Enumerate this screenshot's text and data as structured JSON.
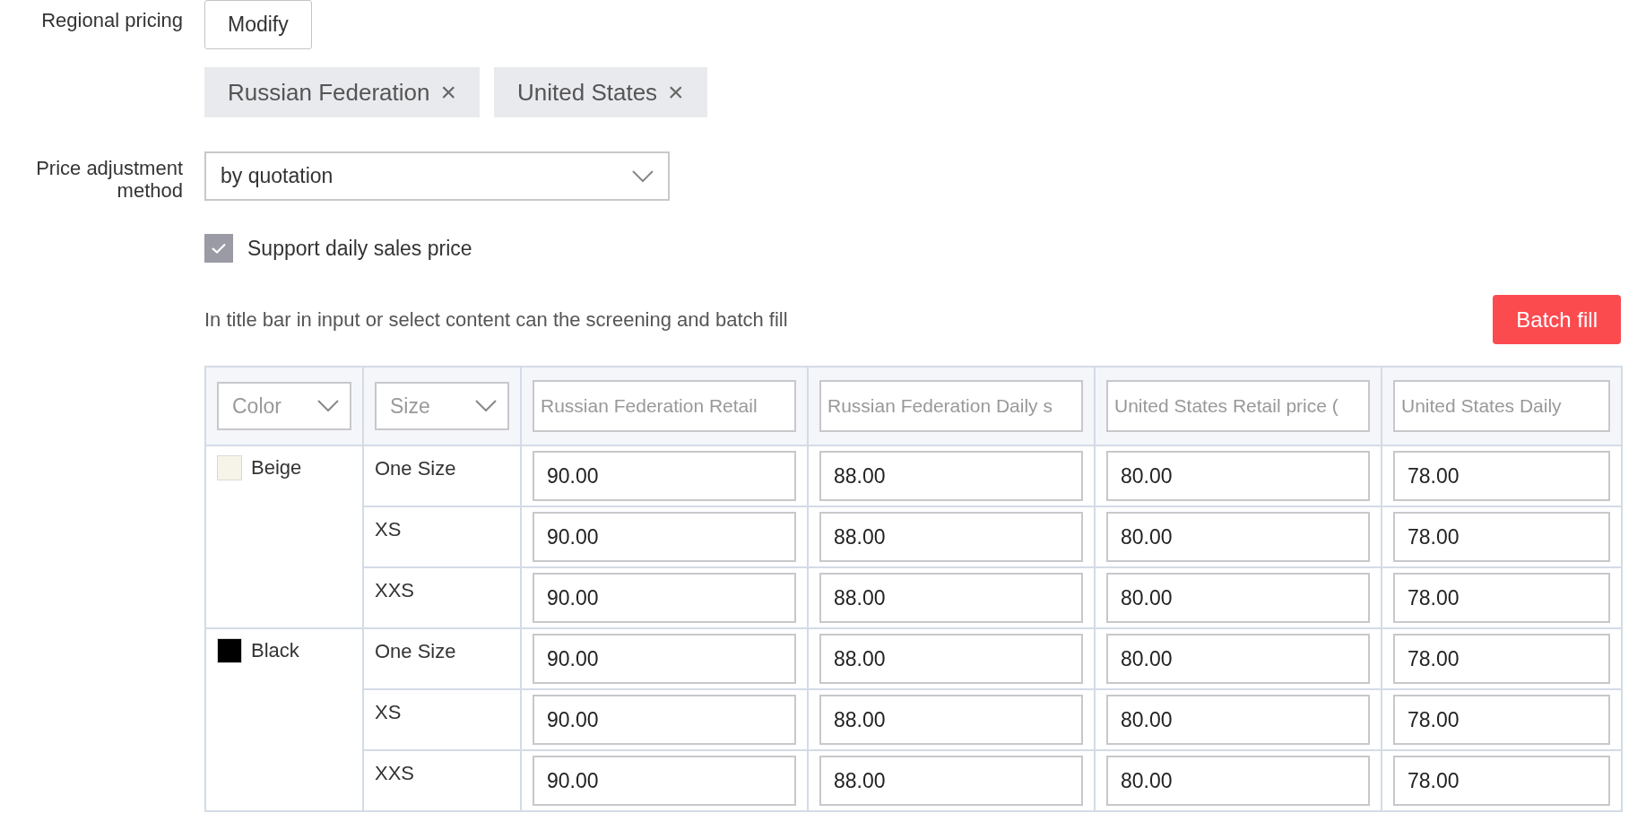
{
  "regional_pricing": {
    "label": "Regional pricing",
    "button": "Modify",
    "regions": [
      {
        "name": "Russian Federation",
        "remove": "×"
      },
      {
        "name": "United States",
        "remove": "×"
      }
    ]
  },
  "price_adjustment": {
    "label": "Price adjustment method",
    "value": "by quotation"
  },
  "daily_price": {
    "label": "Support daily sales price",
    "checked": true
  },
  "hint": "In title bar in input or select content can the screening and batch fill",
  "batch_fill": "Batch fill",
  "table": {
    "columns": [
      {
        "kind": "select",
        "placeholder": "Color"
      },
      {
        "kind": "select",
        "placeholder": "Size"
      },
      {
        "kind": "input",
        "placeholder": "Russian Federation Retail"
      },
      {
        "kind": "input",
        "placeholder": "Russian Federation Daily s"
      },
      {
        "kind": "input",
        "placeholder": "United States Retail price ("
      },
      {
        "kind": "input",
        "placeholder": "United States Daily"
      }
    ],
    "groups": [
      {
        "name": "Beige",
        "color": "#f6f4e8",
        "rows": [
          {
            "size": "One Size",
            "prices": [
              "90.00",
              "88.00",
              "80.00",
              "78.00"
            ]
          },
          {
            "size": "XS",
            "prices": [
              "90.00",
              "88.00",
              "80.00",
              "78.00"
            ]
          },
          {
            "size": "XXS",
            "prices": [
              "90.00",
              "88.00",
              "80.00",
              "78.00"
            ]
          }
        ]
      },
      {
        "name": "Black",
        "color": "#000000",
        "rows": [
          {
            "size": "One Size",
            "prices": [
              "90.00",
              "88.00",
              "80.00",
              "78.00"
            ]
          },
          {
            "size": "XS",
            "prices": [
              "90.00",
              "88.00",
              "80.00",
              "78.00"
            ]
          },
          {
            "size": "XXS",
            "prices": [
              "90.00",
              "88.00",
              "80.00",
              "78.00"
            ]
          }
        ]
      }
    ]
  }
}
